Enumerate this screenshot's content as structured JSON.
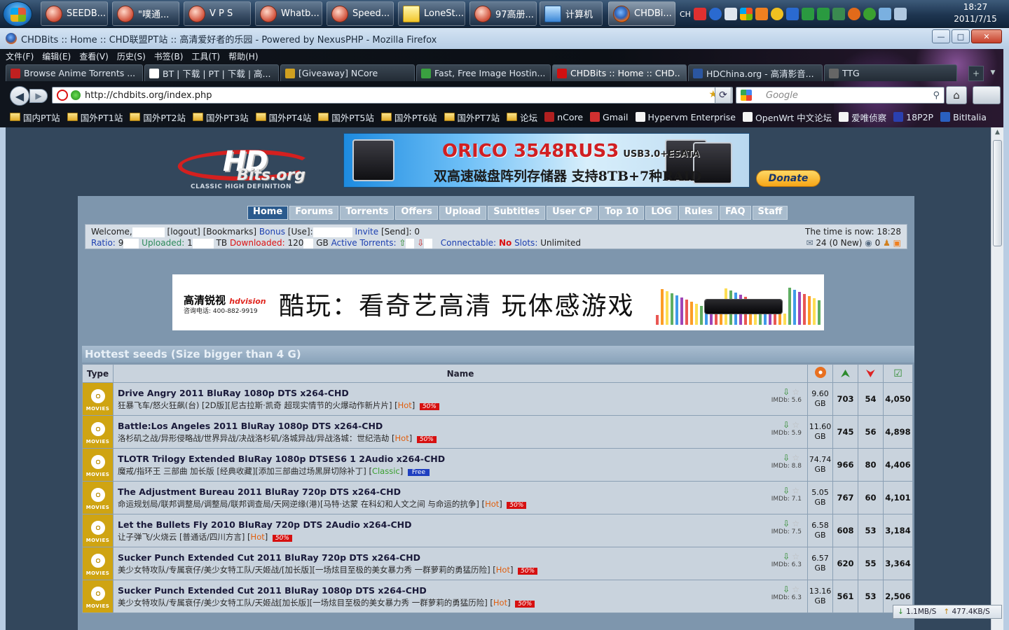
{
  "taskbar": {
    "buttons": [
      {
        "label": "SEEDB...",
        "icon": "msn-icon"
      },
      {
        "label": "\"噗通...",
        "icon": "msn-icon"
      },
      {
        "label": "V P S",
        "icon": "msn-icon"
      },
      {
        "label": "Whatb...",
        "icon": "msn-icon"
      },
      {
        "label": "Speed...",
        "icon": "msn-icon"
      },
      {
        "label": "LoneSt...",
        "icon": "note-icon"
      },
      {
        "label": "97高册...",
        "icon": "msn-icon"
      },
      {
        "label": "计算机",
        "icon": "computer-icon"
      },
      {
        "label": "CHDBi...",
        "icon": "firefox-icon"
      }
    ],
    "tray_lang": "CH",
    "time": "18:27",
    "date": "2011/7/15"
  },
  "window": {
    "title": "CHDBits :: Home :: CHD联盟PT站 :: 高清爱好者的乐园 - Powered by NexusPHP - Mozilla Firefox",
    "menu": [
      "文件(F)",
      "编辑(E)",
      "查看(V)",
      "历史(S)",
      "书签(B)",
      "工具(T)",
      "帮助(H)"
    ]
  },
  "tabs": [
    {
      "label": "Browse Anime Torrents ...",
      "color": "#c02020"
    },
    {
      "label": "BT | 下载 | PT | 下载 | 高...",
      "color": "#ffffff"
    },
    {
      "label": "[Giveaway] NCore",
      "color": "#d0a020"
    },
    {
      "label": "Fast, Free Image Hostin...",
      "color": "#3aa040"
    },
    {
      "label": "CHDBits :: Home :: CHD...",
      "color": "#d11010"
    },
    {
      "label": "HDChina.org - 高清影音...",
      "color": "#2b56a0"
    },
    {
      "label": "TTG",
      "color": "#666666"
    }
  ],
  "address": {
    "url": "http://chdbits.org/index.php",
    "search_placeholder": "Google"
  },
  "bookmarks": [
    {
      "label": "国内PT站",
      "type": "folder"
    },
    {
      "label": "国外PT1站",
      "type": "folder"
    },
    {
      "label": "国外PT2站",
      "type": "folder"
    },
    {
      "label": "国外PT3站",
      "type": "folder"
    },
    {
      "label": "国外PT4站",
      "type": "folder"
    },
    {
      "label": "国外PT5站",
      "type": "folder"
    },
    {
      "label": "国外PT6站",
      "type": "folder"
    },
    {
      "label": "国外PT7站",
      "type": "folder"
    },
    {
      "label": "论坛",
      "type": "folder"
    },
    {
      "label": "nCore",
      "type": "link"
    },
    {
      "label": "Gmail",
      "type": "link"
    },
    {
      "label": "Hypervm Enterprise",
      "type": "link"
    },
    {
      "label": "OpenWrt 中文论坛",
      "type": "link"
    },
    {
      "label": "爱唯侦察",
      "type": "link"
    },
    {
      "label": "18P2P",
      "type": "link"
    },
    {
      "label": "BitItalia",
      "type": "link"
    }
  ],
  "site": {
    "logo_hd": "HD",
    "logo_bits": "Bits.org",
    "logo_tagline": "CLASSIC HIGH DEFINITION",
    "banner_top_title": "ORICO 3548RUS3",
    "banner_top_suffix": "USB3.0+ESATA",
    "banner_top_sub": "双高速磁盘阵列存储器 支持8TB+7种RAID",
    "donate": "Donate",
    "nav": [
      "Home",
      "Forums",
      "Torrents",
      "Offers",
      "Upload",
      "Subtitles",
      "User CP",
      "Top 10",
      "LOG",
      "Rules",
      "FAQ",
      "Staff"
    ],
    "info": {
      "welcome": "Welcome,",
      "logout": "[logout]",
      "bookmarks": "[Bookmarks]",
      "bonus": "Bonus",
      "use": "[Use]:",
      "invite": "Invite",
      "send": "[Send]: 0",
      "ratio_label": "Ratio:",
      "ratio_val": "9",
      "uploaded_label": "Uploaded:",
      "uploaded_val": "1",
      "tb": "TB",
      "downloaded_label": "Downloaded:",
      "downloaded_val": "120",
      "gb": "GB",
      "active_label": "Active Torrents:",
      "connectable_label": "Connectable:",
      "connectable_val": "No",
      "slots_label": "Slots:",
      "slots_val": "Unlimited",
      "time_now": "The time is now: 18:28",
      "messages": "24 (0 New)",
      "msg_extra": "0"
    },
    "banner_mid_brand": "高清锐视",
    "banner_mid_brand_en": "hdvision",
    "banner_mid_phone": "咨询电话: 400-882-9919",
    "banner_mid_slogan": "酷玩：看奇艺高清  玩体感游戏",
    "section_title": "Hottest seeds (Size bigger than 4 G)",
    "col_type": "Type",
    "col_name": "Name",
    "type_label": "MOVIES"
  },
  "torrents": [
    {
      "title": "Drive Angry 2011 BluRay 1080p DTS x264-CHD",
      "sub": "狂暴飞车/怒火狂飙(台) [2D版][尼古拉斯·凯奇 超现实情节的火爆动作新片片]",
      "tag": "Hot",
      "promo": "50%",
      "imdb": "IMDb: 5.6",
      "size": "9.60",
      "unit": "GB",
      "seeders": "703",
      "leechers": "54",
      "completed": "4,050"
    },
    {
      "title": "Battle:Los Angeles 2011 BluRay 1080p DTS x264-CHD",
      "sub": "洛杉矶之战/异形侵略战/世界异战/决战洛杉矶/洛城异战/异战洛城：世纪浩劫",
      "tag": "Hot",
      "promo": "50%",
      "imdb": "IMDb: 5.9",
      "size": "11.60",
      "unit": "GB",
      "seeders": "745",
      "leechers": "56",
      "completed": "4,898"
    },
    {
      "title": "TLOTR Trilogy Extended BluRay 1080p DTSES6 1 2Audio x264-CHD",
      "sub": "魔戒/指环王 三部曲 加长版 [经典收藏][添加三部曲过场黑屏切除补丁]",
      "tag": "Classic",
      "promo": "Free",
      "imdb": "IMDb: 8.8",
      "size": "74.74",
      "unit": "GB",
      "seeders": "966",
      "leechers": "80",
      "completed": "4,406"
    },
    {
      "title": "The Adjustment Bureau 2011 BluRay 720p DTS x264-CHD",
      "sub": "命运规划局/联邦调整局/调整局/联邦调查局/天网逆缘(港)[马特·达蒙 在科幻和人文之间 与命运的抗争]",
      "tag": "Hot",
      "promo": "50%",
      "imdb": "IMDb: 7.1",
      "size": "5.05",
      "unit": "GB",
      "seeders": "767",
      "leechers": "60",
      "completed": "4,101"
    },
    {
      "title": "Let the Bullets Fly 2010 BluRay 720p DTS 2Audio x264-CHD",
      "sub": "让子弹飞/火烧云 [普通话/四川方言]",
      "tag": "Hot",
      "promo": "50%",
      "imdb": "IMDb: 7.5",
      "size": "6.58",
      "unit": "GB",
      "seeders": "608",
      "leechers": "53",
      "completed": "3,184"
    },
    {
      "title": "Sucker Punch Extended Cut 2011 BluRay 720p DTS x264-CHD",
      "sub": "美少女特攻队/专属衰仔/美少女特工队/天姬战/[加长版][一场炫目至极的美女暴力秀 一群萝莉的勇猛历险]",
      "tag": "Hot",
      "promo": "50%",
      "imdb": "IMDb: 6.3",
      "size": "6.57",
      "unit": "GB",
      "seeders": "620",
      "leechers": "55",
      "completed": "3,364"
    },
    {
      "title": "Sucker Punch Extended Cut 2011 BluRay 1080p DTS x264-CHD",
      "sub": "美少女特攻队/专属衰仔/美少女特工队/天姬战[加长版][一场炫目至极的美女暴力秀 一群萝莉的勇猛历险]",
      "tag": "Hot",
      "promo": "50%",
      "imdb": "IMDb: 6.3",
      "size": "13.16",
      "unit": "GB",
      "seeders": "561",
      "leechers": "53",
      "completed": "2,506"
    }
  ],
  "status": {
    "down": "1.1MB/S",
    "up": "477.4KB/S"
  }
}
